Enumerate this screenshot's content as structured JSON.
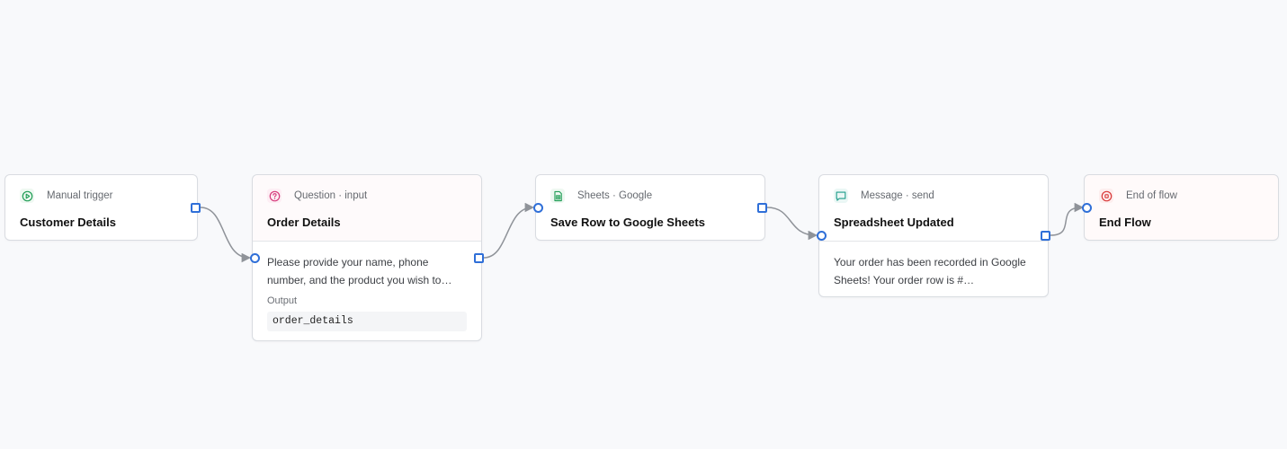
{
  "nodes": [
    {
      "type_label": "Manual trigger",
      "title": "Customer Details",
      "icon": "play-circle-icon",
      "color": "#1f9d55"
    },
    {
      "type_label": "Question · input",
      "title": "Order Details",
      "icon": "question-circle-icon",
      "color": "#d63a7b",
      "body_text": "Please provide your name, phone number, and the product you wish to…",
      "output_label": "Output",
      "output_value": "order_details"
    },
    {
      "type_label": "Sheets · Google",
      "title": "Save Row to Google Sheets",
      "icon": "spreadsheet-icon",
      "color": "#1f9d55"
    },
    {
      "type_label": "Message · send",
      "title": "Spreadsheet Updated",
      "icon": "chat-bubble-icon",
      "color": "#1f9d8a",
      "body_text": "Your order has been recorded in Google Sheets! Your order row is #…"
    },
    {
      "type_label": "End of flow",
      "title": "End Flow",
      "icon": "stop-circle-icon",
      "color": "#d93838"
    }
  ],
  "theme": {
    "port_color": "#2f6fd8",
    "edge_color": "#8f9399"
  }
}
